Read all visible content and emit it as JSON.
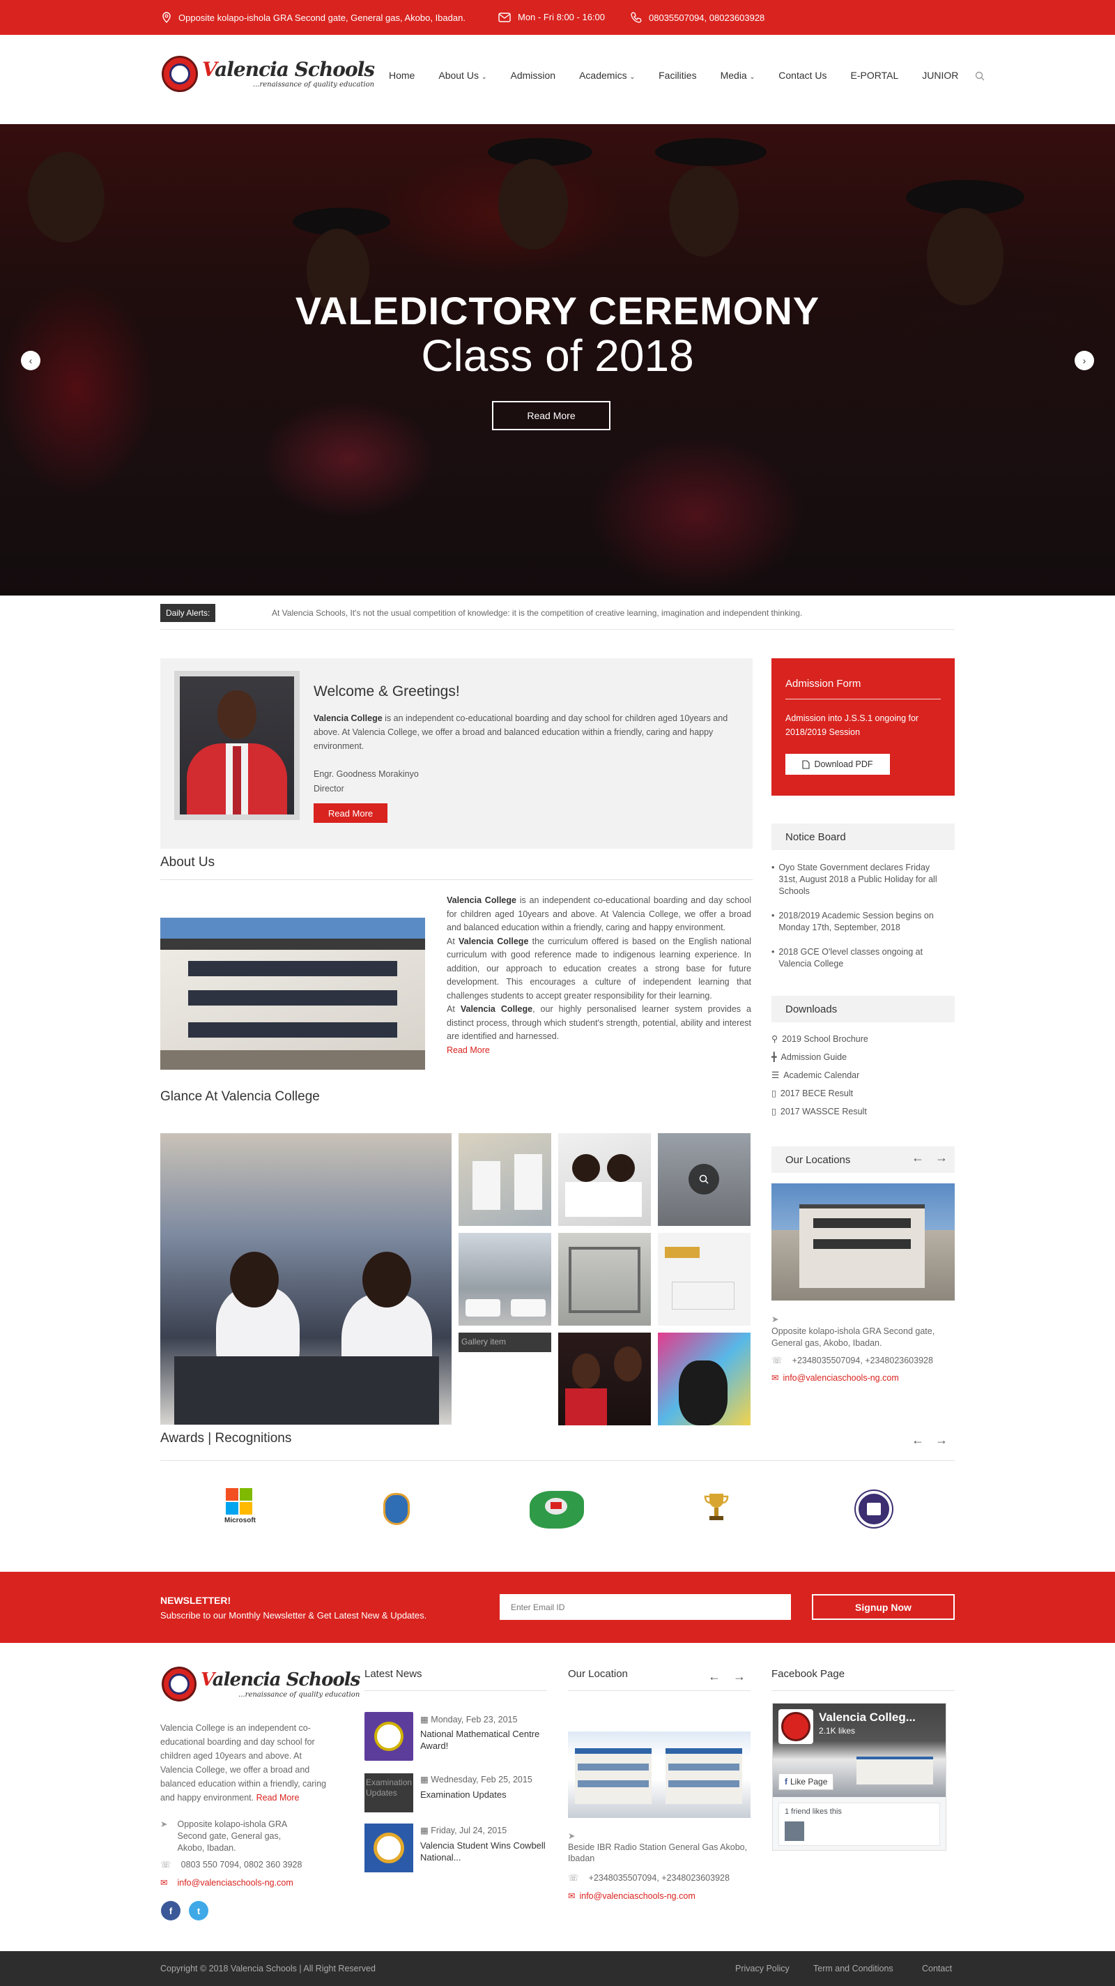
{
  "topbar": {
    "address": "Opposite kolapo-ishola GRA Second gate, General gas, Akobo, Ibadan.",
    "hours": "Mon - Fri 8:00 - 16:00",
    "phones": "08035507094, 08023603928"
  },
  "logo": {
    "name_initial": "V",
    "name_rest": "alencia Schools",
    "tagline": "...renaissance of quality education"
  },
  "nav": {
    "items": [
      {
        "label": "Home",
        "dropdown": false
      },
      {
        "label": "About Us",
        "dropdown": true
      },
      {
        "label": "Admission",
        "dropdown": false
      },
      {
        "label": "Academics",
        "dropdown": true
      },
      {
        "label": "Facilities",
        "dropdown": false
      },
      {
        "label": "Media",
        "dropdown": true
      },
      {
        "label": "Contact Us",
        "dropdown": false
      },
      {
        "label": "E-PORTAL",
        "dropdown": false
      },
      {
        "label": "JUNIOR",
        "dropdown": false
      }
    ],
    "search_icon": "search-icon"
  },
  "hero": {
    "title": "VALEDICTORY CEREMONY",
    "subtitle": "Class of 2018",
    "button": "Read More",
    "prev_icon": "chevron-left-icon",
    "next_icon": "chevron-right-icon"
  },
  "alerts": {
    "label": "Daily Alerts:",
    "text": "At Valencia Schools, It's not the usual competition of knowledge: it is the competition of creative learning, imagination and independent thinking."
  },
  "welcome": {
    "title": "Welcome & Greetings!",
    "name_bold": "Valencia College",
    "text": " is an independent co-educational boarding and day school for children aged 10years and above. At Valencia College, we offer a broad and balanced education within a friendly, caring and happy environment.",
    "signatory": "Engr. Goodness Morakinyo",
    "role": "Director",
    "button": "Read More"
  },
  "admission": {
    "title": "Admission Form",
    "text": "Admission into J.S.S.1 ongoing for 2018/2019 Session",
    "button": "Download PDF"
  },
  "notice_board": {
    "title": "Notice Board",
    "items": [
      "Oyo State Government declares Friday 31st, August 2018 a Public Holiday for all Schools",
      "2018/2019 Academic Session begins on Monday 17th, September, 2018",
      "2018 GCE O'level classes ongoing at Valencia College"
    ]
  },
  "downloads": {
    "title": "Downloads",
    "items": [
      {
        "label": "2019 School Brochure",
        "icon": "tag-icon"
      },
      {
        "label": "Admission Guide",
        "icon": "signpost-icon"
      },
      {
        "label": "Academic Calendar",
        "icon": "list-icon"
      },
      {
        "label": "2017 BECE Result",
        "icon": "bookmark-icon"
      },
      {
        "label": "2017 WASSCE Result",
        "icon": "bookmark-icon"
      }
    ]
  },
  "locations": {
    "title": "Our Locations",
    "address": "Opposite kolapo-ishola GRA Second gate, General gas, Akobo, Ibadan.",
    "phones": "+2348035507094, +2348023603928",
    "email": "info@valenciaschools-ng.com"
  },
  "about": {
    "title": "About Us",
    "p1_bold": "Valencia College",
    "p1": " is an independent co-educational boarding and day school for children aged 10years and above. At Valencia College, we offer a broad and balanced education within a friendly, caring and happy environment.",
    "p2_pre": "At ",
    "p2_bold": "Valencia College",
    "p2": " the curriculum offered is based on the English national curriculum with good reference made to indigenous learning experience. In addition, our approach to education creates a strong base for future development. This encourages a culture of independent learning that challenges students to accept greater responsibility for their learning.",
    "p3_pre": "At ",
    "p3_bold": "Valencia College",
    "p3": ", our highly personalised learner system provides a distinct process, through which student's strength, potential, ability and interest are identified and harnessed.",
    "read_more": "Read More"
  },
  "glance": {
    "title": "Glance At Valencia College",
    "broken_alt": "Gallery item"
  },
  "awards": {
    "title": "Awards | Recognitions",
    "items": [
      "Microsoft",
      "",
      "",
      "",
      ""
    ]
  },
  "newsletter": {
    "title": "NEWSLETTER!",
    "subtitle": "Subscribe to our Monthly Newsletter & Get Latest New & Updates.",
    "placeholder": "Enter Email ID",
    "button": "Signup Now"
  },
  "footer": {
    "about": "Valencia College is an independent co-educational boarding and day school for children aged 10years and above. At Valencia College, we offer a broad and balanced education within a friendly, caring and happy environment.",
    "read_more": "Read More",
    "address": "Opposite kolapo-ishola GRA Second gate, General gas, Akobo, Ibadan.",
    "phones": "0803 550 7094, 0802 360 3928",
    "email": "info@valenciaschools-ng.com",
    "latest_news": {
      "title": "Latest News",
      "items": [
        {
          "date": "Monday, Feb 23, 2015",
          "title": "National Mathematical Centre Award!"
        },
        {
          "date": "Wednesday, Feb 25, 2015",
          "title": "Examination Updates",
          "alt": "Examination Updates"
        },
        {
          "date": "Friday, Jul 24, 2015",
          "title": "Valencia Student Wins Cowbell National..."
        }
      ]
    },
    "our_location": {
      "title": "Our Location",
      "address": "Beside IBR Radio Station General Gas Akobo, Ibadan",
      "phones": "+2348035507094, +2348023603928",
      "email": "info@valenciaschools-ng.com"
    },
    "facebook": {
      "title": "Facebook Page",
      "page_name": "Valencia Colleg...",
      "likes": "2.1K likes",
      "like_button": "Like Page",
      "friends": "1 friend likes this"
    }
  },
  "bottom": {
    "copyright": "Copyright © 2018 Valencia Schools | All Right Reserved",
    "links": [
      "Privacy Policy",
      "Term and Conditions",
      "Contact"
    ]
  },
  "colors": {
    "brand_red": "#d9231f",
    "dark": "#2d2d2d"
  }
}
